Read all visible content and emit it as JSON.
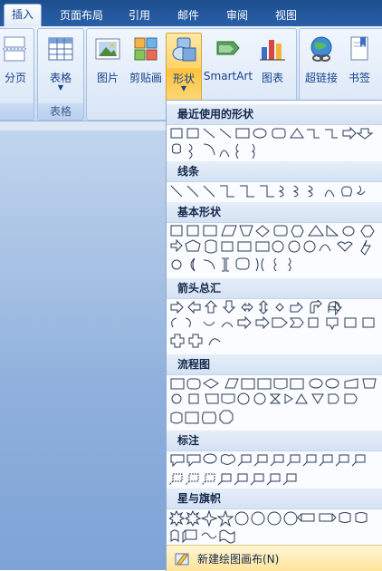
{
  "tabs": [
    {
      "label": "插入",
      "active": true
    },
    {
      "label": "页面布局",
      "active": false
    },
    {
      "label": "引用",
      "active": false
    },
    {
      "label": "邮件",
      "active": false
    },
    {
      "label": "审阅",
      "active": false
    },
    {
      "label": "视图",
      "active": false
    }
  ],
  "ribbon": {
    "page_break_label": "分页",
    "table_label": "表格",
    "table_group_label": "表格",
    "picture_label": "图片",
    "clipart_label": "剪贴画",
    "shapes_label": "形状",
    "smartart_label": "SmartArt",
    "chart_label": "图表",
    "hyperlink_label": "超链接",
    "bookmark_label": "书签"
  },
  "gallery": {
    "sections": [
      {
        "title": "最近使用的形状"
      },
      {
        "title": "线条"
      },
      {
        "title": "基本形状"
      },
      {
        "title": "箭头总汇"
      },
      {
        "title": "流程图"
      },
      {
        "title": "标注"
      },
      {
        "title": "星与旗帜"
      }
    ],
    "footer_label": "新建绘图画布(N)"
  },
  "colors": {
    "accent": "#15428b",
    "tabbar": "#2a5fa8",
    "shapes_highlight": "#ffd46b"
  }
}
